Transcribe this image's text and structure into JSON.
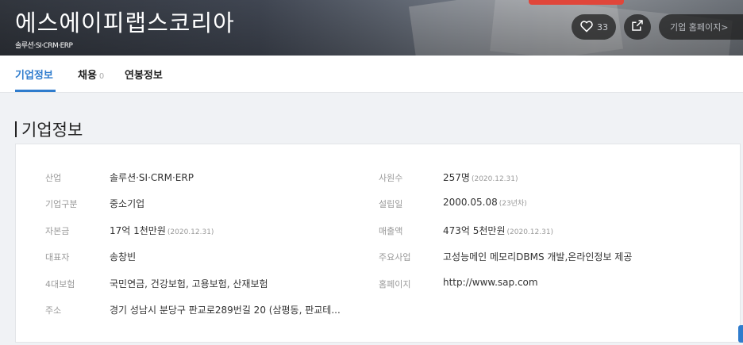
{
  "header": {
    "company_name": "에스에이피랩스코리아",
    "industry_tag": "솔루션·SI·CRM·ERP",
    "like_count": "33",
    "homepage_button": "기업 홈페이지>"
  },
  "tabs": [
    {
      "label": "기업정보"
    },
    {
      "label": "채용",
      "count": "0"
    },
    {
      "label": "연봉정보"
    }
  ],
  "section": {
    "title": "기업정보"
  },
  "info": {
    "industry_label": "산업",
    "industry_value": "솔루션·SI·CRM·ERP",
    "type_label": "기업구분",
    "type_value": "중소기업",
    "capital_label": "자본금",
    "capital_value": "17억 1천만원",
    "capital_note": "(2020.12.31)",
    "ceo_label": "대표자",
    "ceo_value": "송창빈",
    "insurance_label": "4대보험",
    "insurance_value": "국민연금, 건강보험, 고용보험, 산재보험",
    "address_label": "주소",
    "address_value": "경기 성남시 분당구 판교로289번길 20 (삼평동, 판교테...",
    "employees_label": "사원수",
    "employees_value": "257명",
    "employees_note": "(2020.12.31)",
    "founded_label": "설립일",
    "founded_value": "2000.05.08",
    "founded_note": "(23년차)",
    "revenue_label": "매출액",
    "revenue_value": "473억 5천만원",
    "revenue_note": "(2020.12.31)",
    "business_label": "주요사업",
    "business_value": "고성능메인 메모리DBMS 개발,온라인정보 제공",
    "homepage_label": "홈페이지",
    "homepage_value": "http://www.sap.com"
  },
  "colors": {
    "accent": "#2f7ccd",
    "banner_highlight": "#e0463a"
  }
}
